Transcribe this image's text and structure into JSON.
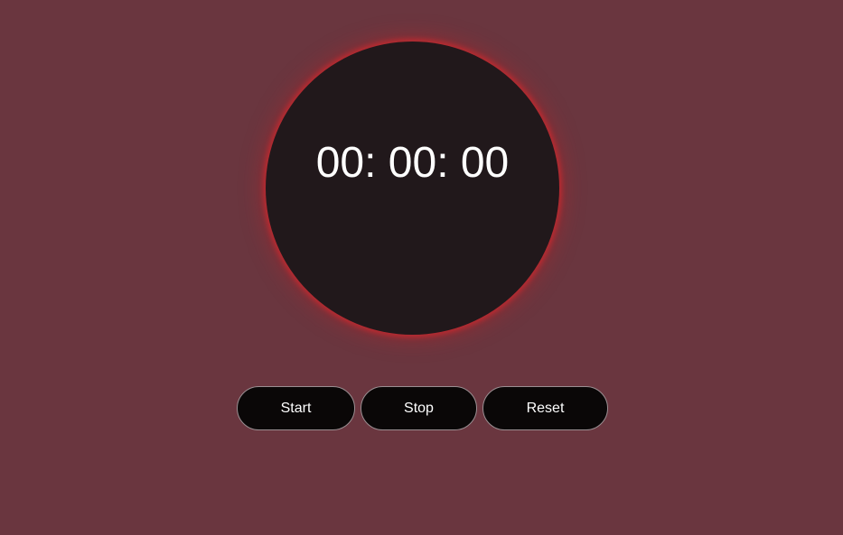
{
  "timer": {
    "display": "00: 00: 00"
  },
  "controls": {
    "start_label": "Start",
    "stop_label": "Stop",
    "reset_label": "Reset"
  },
  "colors": {
    "background": "#6a363f",
    "clock_face": "#21181b",
    "glow": "#cd282d",
    "button_bg": "#0a0707",
    "text": "#ffffff"
  }
}
